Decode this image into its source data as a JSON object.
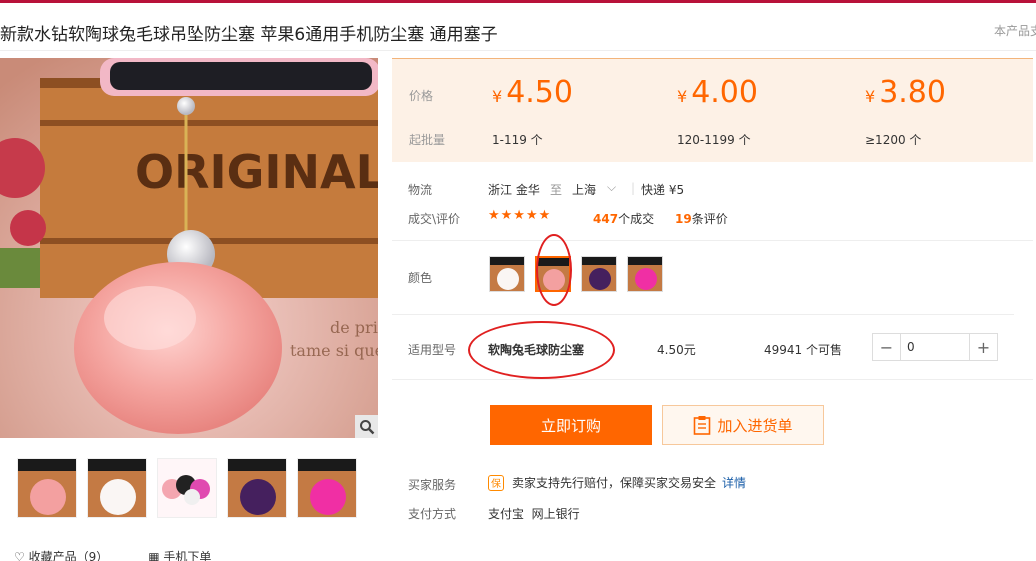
{
  "product": {
    "title": "新款水钻软陶球兔毛球吊坠防尘塞 苹果6通用手机防尘塞 通用塞子",
    "side_note": "本产品支"
  },
  "prices": {
    "price_label": "价格",
    "batch_label": "起批量",
    "currency": "¥",
    "tiers": [
      {
        "price": "4.50",
        "qty": "1-119 个"
      },
      {
        "price": "4.00",
        "qty": "120-1199 个"
      },
      {
        "price": "3.80",
        "qty": "≥1200 个"
      }
    ]
  },
  "logistics": {
    "label": "物流",
    "from": "浙江 金华",
    "to_word": "至",
    "to": "上海",
    "shipping": "快递 ¥5"
  },
  "deals": {
    "label": "成交\\评价",
    "stars": "★★★★★",
    "count": "447",
    "count_suffix": "个成交",
    "reviews": "19",
    "reviews_suffix": "条评价"
  },
  "color": {
    "label": "颜色",
    "options": [
      "white",
      "pink",
      "purple",
      "magenta"
    ],
    "selected": "pink"
  },
  "model": {
    "label": "适用型号",
    "name": "软陶兔毛球防尘塞",
    "price": "4.50元",
    "stock": "49941 个可售",
    "qty_value": "0"
  },
  "actions": {
    "buy": "立即订购",
    "cart": "加入进货单"
  },
  "service": {
    "label": "买家服务",
    "badge": "保",
    "text": "卖家支持先行赔付，保障买家交易安全",
    "link": "详情"
  },
  "payment": {
    "label": "支付方式",
    "methods": "支付宝  网上银行"
  },
  "footer": {
    "favorite": "收藏产品（9）",
    "mobile": "手机下单"
  },
  "colors": {
    "accent": "#ff6600",
    "topbar": "#b8123a",
    "price_bg": "#fdf1e6",
    "annotation": "#e02020"
  }
}
